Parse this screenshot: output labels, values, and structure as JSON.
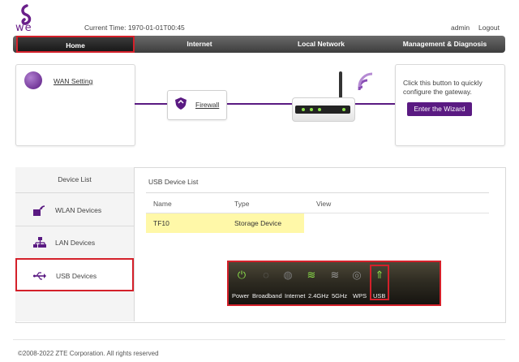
{
  "brand": {
    "logo_text": "we",
    "accent": "#5a1a82",
    "highlight": "#d4202a"
  },
  "header": {
    "current_time": "Current Time: 1970-01-01T00:45",
    "user": "admin",
    "logout": "Logout"
  },
  "nav": {
    "items": [
      "Home",
      "Internet",
      "Local Network",
      "Management & Diagnosis"
    ],
    "active": "Home"
  },
  "wan": {
    "link": "WAN Setting"
  },
  "firewall": {
    "link": "Firewall"
  },
  "wizard": {
    "text": "Click this button to quickly configure the gateway.",
    "button": "Enter the Wizard"
  },
  "sidebar": {
    "title": "Device List",
    "items": [
      {
        "label": "WLAN Devices",
        "icon": "wlan-icon"
      },
      {
        "label": "LAN Devices",
        "icon": "lan-icon"
      },
      {
        "label": "USB Devices",
        "icon": "usb-icon"
      }
    ]
  },
  "usb_list": {
    "title": "USB Device List",
    "columns": [
      "Name",
      "Type",
      "View"
    ],
    "rows": [
      {
        "name": "TF10",
        "type": "Storage Device",
        "view": ""
      }
    ]
  },
  "led_panel": {
    "labels": [
      "Power",
      "Broadband",
      "Internet",
      "2.4GHz",
      "5GHz",
      "WPS",
      "USB"
    ],
    "icons": [
      "power-icon",
      "broadband-icon",
      "internet-icon",
      "wifi-24-icon",
      "wifi-5-icon",
      "wps-icon",
      "usb-icon"
    ]
  },
  "footer": {
    "copyright": "©2008-2022 ZTE Corporation. All rights reserved"
  }
}
